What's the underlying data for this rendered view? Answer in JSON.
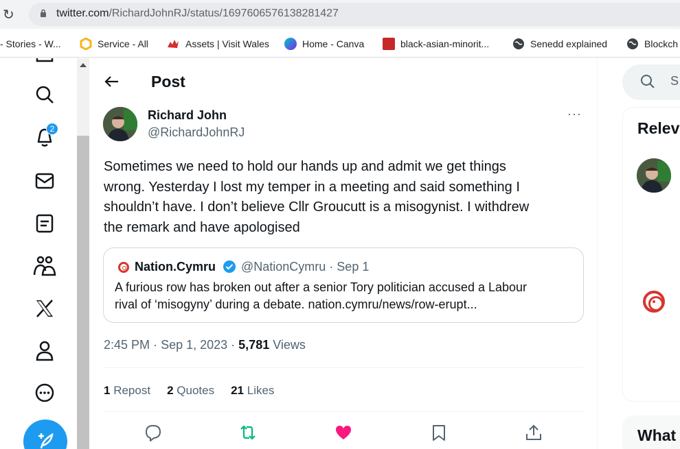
{
  "browser": {
    "url_domain": "twitter.com",
    "url_path": "/RichardJohnRJ/status/1697606576138281427",
    "bookmarks": [
      {
        "label": "- Stories - W...",
        "icon": "none"
      },
      {
        "label": "Service - All",
        "icon": "hexagon-icon",
        "color": "#f9b41d"
      },
      {
        "label": "Assets | Visit Wales",
        "icon": "dragon-icon",
        "color": "#d32f2f"
      },
      {
        "label": "Home - Canva",
        "icon": "canva-icon",
        "color": "#7d2ae8"
      },
      {
        "label": "black-asian-minorit...",
        "icon": "red-square-icon",
        "color": "#c62828"
      },
      {
        "label": "Senedd explained",
        "icon": "globe-icon",
        "color": "#3c4043"
      },
      {
        "label": "Blockch",
        "icon": "globe-icon",
        "color": "#3c4043"
      }
    ]
  },
  "nav": {
    "notification_count": "2",
    "items": [
      "search-icon",
      "bell-icon",
      "mail-icon",
      "list-icon",
      "communities-icon",
      "x-logo-icon",
      "profile-icon",
      "more-icon",
      "compose-icon"
    ]
  },
  "header": {
    "title": "Post"
  },
  "tweet": {
    "author_name": "Richard John",
    "author_handle": "@RichardJohnRJ",
    "more": "···",
    "lines": [
      "Sometimes we need to hold our hands up and admit we get things",
      "wrong. Yesterday I lost my temper in a meeting and said something I",
      "shouldn’t have. I don’t believe Cllr Groucutt is a misogynist. I withdrew",
      "the remark and have apologised"
    ],
    "time": "2:45 PM",
    "date": "Sep 1, 2023",
    "views_count": "5,781",
    "views_label": "Views",
    "reposts_count": "1",
    "reposts_label": "Repost",
    "quotes_count": "2",
    "quotes_label": "Quotes",
    "likes_count": "21",
    "likes_label": "Likes"
  },
  "quote": {
    "name": "Nation.Cymru",
    "handle_date": "@NationCymru · Sep 1",
    "line1": "A furious row has broken out after a senior Tory politician accused a Labour",
    "line2": "rival of ‘misogyny’ during a debate. nation.cymru/news/row-erupt..."
  },
  "sidebar": {
    "search_placeholder": "S",
    "relevant_title": "Relev",
    "what_title": "What"
  },
  "colors": {
    "accent": "#1d9bf0",
    "like": "#f91880",
    "repost": "#00ba7c",
    "nation_red": "#d6362f"
  }
}
